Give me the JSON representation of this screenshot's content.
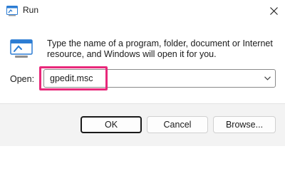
{
  "window": {
    "title": "Run",
    "close_icon": "close-icon",
    "app_icon": "run-icon"
  },
  "description": "Type the name of a program, folder, document or Internet resource, and Windows will open it for you.",
  "open": {
    "label": "Open:",
    "value": "gpedit.msc",
    "dropdown_icon": "chevron-down-icon"
  },
  "buttons": {
    "ok": "OK",
    "cancel": "Cancel",
    "browse": "Browse..."
  },
  "colors": {
    "highlight": "#e8287a",
    "footer_bg": "#f3f3f3",
    "icon_blue": "#2b7cd3"
  }
}
